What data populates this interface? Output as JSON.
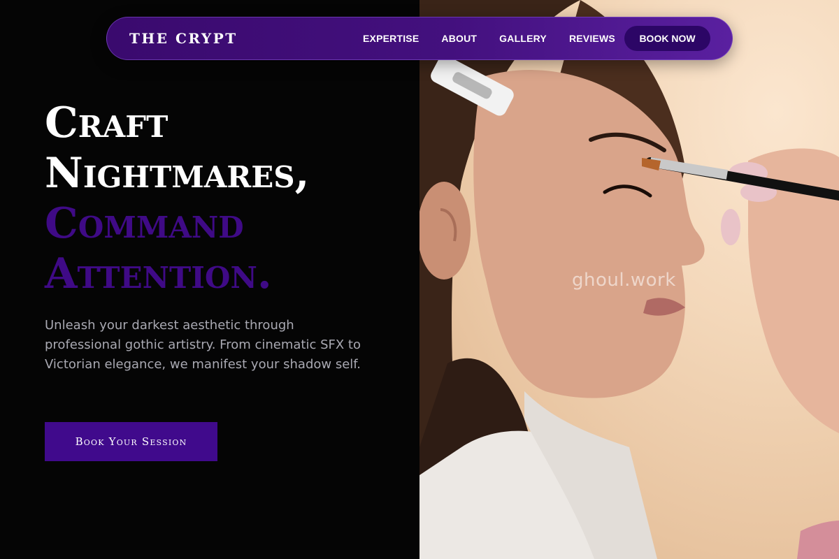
{
  "nav": {
    "brand": "THE CRYPT",
    "links": [
      "EXPERTISE",
      "ABOUT",
      "GALLERY",
      "REVIEWS"
    ],
    "cta_label": "BOOK NOW"
  },
  "hero": {
    "headline": {
      "line1": "Craft",
      "line2": "Nightmares,",
      "line3": "Command",
      "line4": "Attention."
    },
    "tagline": "Unleash your darkest aesthetic through professional gothic artistry. From cinematic SFX to Victorian elegance, we manifest your shadow self.",
    "cta_label": "Book Your Session"
  },
  "image": {
    "watermark": "ghoul.work"
  },
  "colors": {
    "background": "#050505",
    "accent_purple": "#3f0a86",
    "nav_purple": "#43107e",
    "button_purple": "#400a8c",
    "tagline_gray": "#a9a9b2"
  }
}
